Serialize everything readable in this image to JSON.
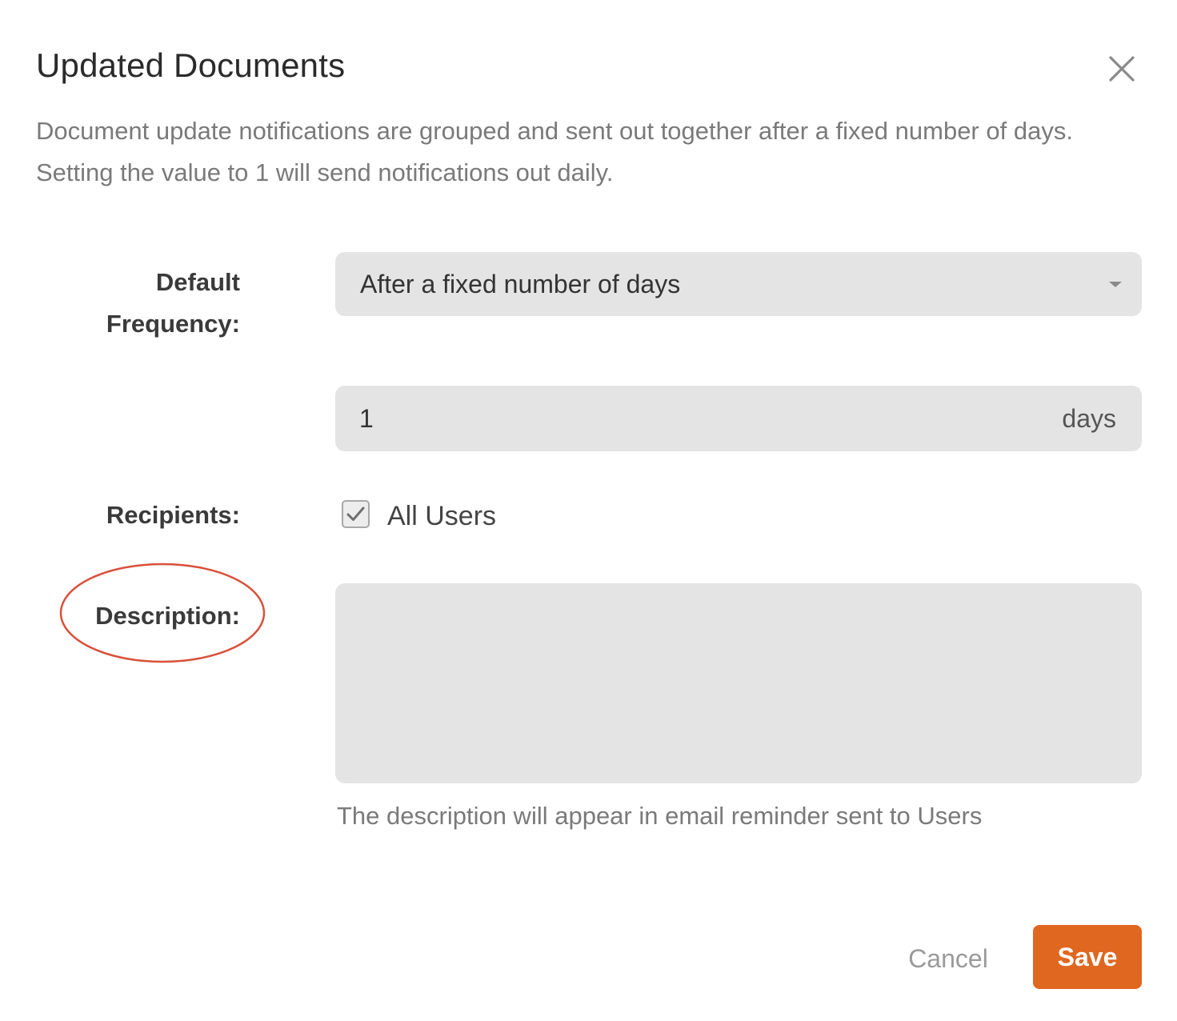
{
  "dialog": {
    "title": "Updated Documents",
    "intro": "Document update notifications are grouped and sent out together after a fixed number of days. Setting the value to 1 will send notifications out daily."
  },
  "form": {
    "frequency_label": "Default Frequency:",
    "frequency_value": "After a fixed number of days",
    "days_value": "1",
    "days_unit": "days",
    "recipients_label": "Recipients:",
    "all_users_label": "All Users",
    "all_users_checked": true,
    "description_label": "Description:",
    "description_value": "",
    "description_hint": "The description will appear in email reminder sent to Users"
  },
  "actions": {
    "cancel_label": "Cancel",
    "save_label": "Save"
  },
  "colors": {
    "accent": "#e0671f",
    "field_bg": "#e4e4e4",
    "annotation": "#d9503a"
  },
  "icons": {
    "close": "close-icon",
    "dropdown": "chevron-down-icon",
    "check": "checkmark-icon"
  }
}
